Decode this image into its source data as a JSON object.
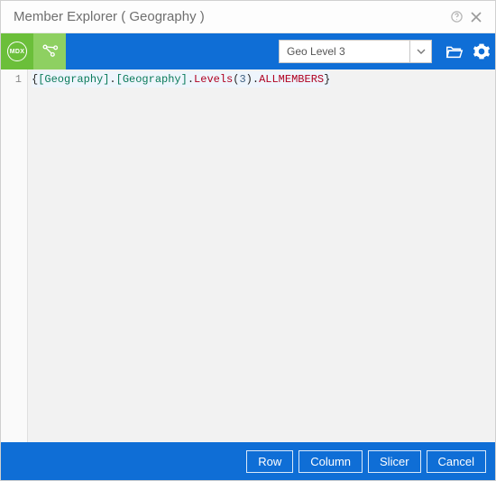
{
  "window": {
    "title": "Member Explorer ( Geography )"
  },
  "toolbar": {
    "mdx_badge": "MDX",
    "level_selected": "Geo Level 3"
  },
  "editor": {
    "line_number": "1",
    "tokens": {
      "open_brace": "{",
      "dim1": "[Geography]",
      "dot1": ".",
      "dim2": "[Geography]",
      "dot2": ".",
      "func": "Levels",
      "paren_open": "(",
      "arg": "3",
      "paren_close": ")",
      "dot3": ".",
      "kw": "ALLMEMBERS",
      "close_brace": "}"
    }
  },
  "footer": {
    "row": "Row",
    "column": "Column",
    "slicer": "Slicer",
    "cancel": "Cancel"
  }
}
